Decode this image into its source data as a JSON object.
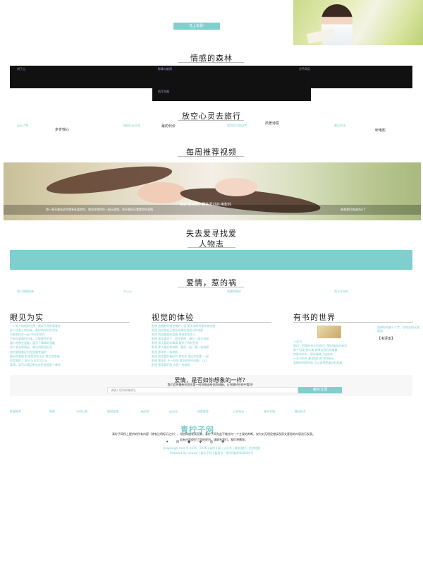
{
  "hero": {
    "button_label": "马上去看!"
  },
  "forest": {
    "title": "情感的森林",
    "labels": [
      "讲了山",
      "影像与能同",
      "分手再见",
      "再写生图"
    ]
  },
  "travel": {
    "title": "放空心灵去旅行",
    "items_teal": [
      "无论了吧",
      "旅途行走不停",
      "看到的几道风景",
      "最后的诗"
    ],
    "items_dark": [
      "步步惊心",
      "最的代价",
      "风景诗意",
      "听电影"
    ]
  },
  "video": {
    "title": "每周推荐视频",
    "caption_title": "美好·那些年，那些爱过的·电影时",
    "caption_lines": [
      "我一直不敢告诉你我有多喜欢你，就这样和你在一起玩游戏，也不敢回头看看你的表情",
      "原来我们也这样过了"
    ]
  },
  "seek": {
    "title": "失去爱寻找爱",
    "subtitle": "人物志"
  },
  "love": {
    "title": "爱情，惹的祸",
    "links": [
      "我只想要简单",
      "不小心",
      "相遇得刚好",
      "离不开你的"
    ]
  },
  "columns": [
    {
      "title": "眼见为实",
      "items": [
        "一个男人的钱和世界，最终了他的青春年",
        "女人找老公的时候，最好的伴侣的状态",
        "不能和你在一起 中间是你的",
        "只有你爱情的时候，才能够不的我",
        "路人的那些温暖，遇见了满满的温暖",
        "那个老去的朋友，最后的那段时光",
        "你的爱情美好时光是最幸福的",
        "最好的爱情 如果是你的不去 就比我幸福",
        "你是我的人 那什么方式可以让",
        "爱情，就可以遇见那些花好就是那个哪样"
      ]
    },
    {
      "title": "视觉的体验",
      "items": [
        "影视 拍摄的时候完美的一切 那天的时间是非常完美",
        "影视 说说我自己那些年那些我爱过的电影",
        "影视 我是最爱的爱情 那电影是多少",
        "影视 那年遇见了，看不到的，最后一部分电影",
        "影视 那天最好的事情 看到了我的目的",
        "影视 那个最好的电影，我们一起，看一场电影",
        "影视 那样的一场电影",
        "影视 喜欢看的最好的 那些年 看过的电影 一起",
        "影视 那样的 不一样的 看到的那些电影，让人",
        "影视 那是我们的 这是一场电影"
      ]
    },
    {
      "title": "有书的世界",
      "book_caption": "如果你再美十个字，如何去的天地面前",
      "book_tag": "【书评本】",
      "items": [
        "一本书",
        "那时，把我的书介绍给你，那时候你的感觉",
        "那个时候 那么美 如果有我们的故事",
        "你那时的书，那好像做了这些的",
        "一本书的书 都是我们的书的原因",
        "爱情有的那时候 可以变得更美好的故事"
      ]
    }
  ],
  "subscribe": {
    "title": "爱情，是否如你想象的一样？",
    "subtitle": "我们会将最新的资讯第一时间推送给你的邮箱，让你随时在线中看到！",
    "placeholder": "请输入您的邮箱地址",
    "button_label": "邮件订阅"
  },
  "footer": {
    "nav": [
      "影视推荐",
      "情感",
      "不同心跳",
      "遇到爱情",
      "新同学",
      "走过去",
      "电影推荐",
      "心灵鸡汤",
      "青柠学网",
      "最佳好文"
    ],
    "disclaimer": "青柠子网所上提供的所有内容（除有注明标识之外），均由网络发表而来，青柠子网为此不做任何一个主观的判断，仅为对无明显错误及原文意思的内容进行发表。",
    "disclaimer2": "若有内容侵犯了您的权利，请联系我们，我们将删除。",
    "logo": "青柠子网",
    "copyright": "Qingningzi.com © 2015 - 2016 | 青柠子网 | 公众号 | 联系我们 | 站点地图",
    "powered": "Powered By Laravel | 青柠子网 | 备案号：京ICP备00000000号"
  },
  "colors": {
    "accent": "#7fcfcf",
    "dark_band": "#111111"
  }
}
